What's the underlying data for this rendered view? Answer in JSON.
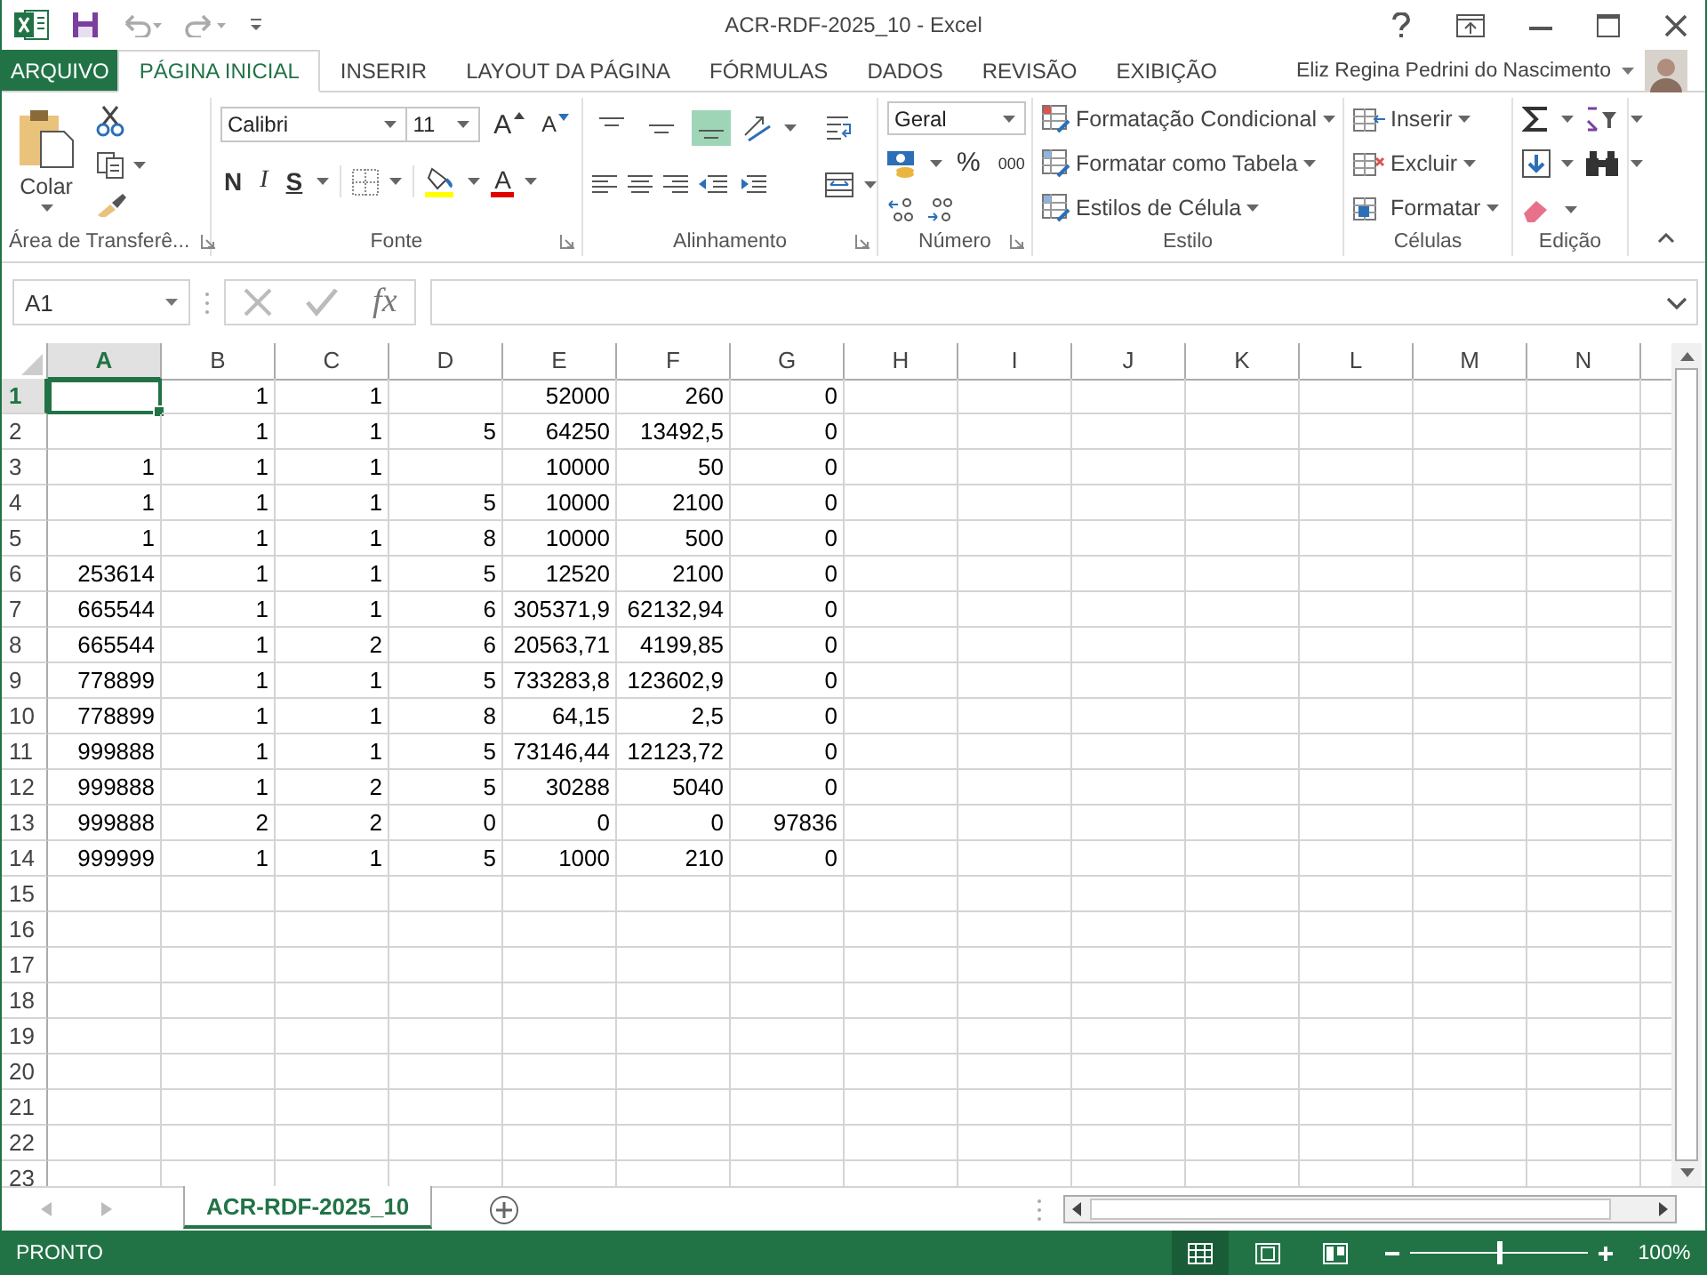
{
  "window": {
    "title": "ACR-RDF-2025_10 - Excel",
    "user": "Eliz Regina Pedrini do Nascimento"
  },
  "tabs": [
    {
      "label": "ARQUIVO",
      "kind": "file",
      "selected": false
    },
    {
      "label": "PÁGINA INICIAL",
      "kind": "tab",
      "selected": true
    },
    {
      "label": "INSERIR",
      "kind": "tab",
      "selected": false
    },
    {
      "label": "LAYOUT DA PÁGINA",
      "kind": "tab",
      "selected": false
    },
    {
      "label": "FÓRMULAS",
      "kind": "tab",
      "selected": false
    },
    {
      "label": "DADOS",
      "kind": "tab",
      "selected": false
    },
    {
      "label": "REVISÃO",
      "kind": "tab",
      "selected": false
    },
    {
      "label": "EXIBIÇÃO",
      "kind": "tab",
      "selected": false
    }
  ],
  "ribbon": {
    "clipboard": {
      "paste": "Colar",
      "label": "Área de Transferê..."
    },
    "font": {
      "name": "Calibri",
      "size": "11",
      "grow": "A",
      "shrink": "A",
      "bold": "N",
      "italic": "I",
      "underline": "S",
      "color_letter": "A",
      "label": "Fonte"
    },
    "alignment": {
      "vertical_align": [
        {
          "selected": false
        },
        {
          "selected": false
        },
        {
          "selected": true
        }
      ],
      "label": "Alinhamento"
    },
    "number": {
      "format": "Geral",
      "percent": "%",
      "thousands": "000",
      "label": "Número"
    },
    "styles": {
      "buttons": [
        "Formatação Condicional",
        "Formatar como Tabela",
        "Estilos de Célula"
      ],
      "label": "Estilo"
    },
    "cells": {
      "buttons": [
        "Inserir",
        "Excluir",
        "Formatar"
      ],
      "label": "Células"
    },
    "editing": {
      "label": "Edição"
    }
  },
  "formula_bar": {
    "name_box": "A1",
    "fx": "fx"
  },
  "sheet": {
    "columns": [
      {
        "label": "A",
        "selected": true
      },
      {
        "label": "B",
        "selected": false
      },
      {
        "label": "C",
        "selected": false
      },
      {
        "label": "D",
        "selected": false
      },
      {
        "label": "E",
        "selected": false
      },
      {
        "label": "F",
        "selected": false
      },
      {
        "label": "G",
        "selected": false
      },
      {
        "label": "H",
        "selected": false
      },
      {
        "label": "I",
        "selected": false
      },
      {
        "label": "J",
        "selected": false
      },
      {
        "label": "K",
        "selected": false
      },
      {
        "label": "L",
        "selected": false
      },
      {
        "label": "M",
        "selected": false
      },
      {
        "label": "N",
        "selected": false
      }
    ],
    "rows": [
      {
        "label": "1",
        "selected": true,
        "cells": [
          null,
          "1",
          "1",
          null,
          "52000",
          "260",
          "0"
        ]
      },
      {
        "label": "2",
        "selected": false,
        "cells": [
          null,
          "1",
          "1",
          "5",
          "64250",
          "13492,5",
          "0"
        ]
      },
      {
        "label": "3",
        "selected": false,
        "cells": [
          "1",
          "1",
          "1",
          null,
          "10000",
          "50",
          "0"
        ]
      },
      {
        "label": "4",
        "selected": false,
        "cells": [
          "1",
          "1",
          "1",
          "5",
          "10000",
          "2100",
          "0"
        ]
      },
      {
        "label": "5",
        "selected": false,
        "cells": [
          "1",
          "1",
          "1",
          "8",
          "10000",
          "500",
          "0"
        ]
      },
      {
        "label": "6",
        "selected": false,
        "cells": [
          "253614",
          "1",
          "1",
          "5",
          "12520",
          "2100",
          "0"
        ]
      },
      {
        "label": "7",
        "selected": false,
        "cells": [
          "665544",
          "1",
          "1",
          "6",
          "305371,9",
          "62132,94",
          "0"
        ]
      },
      {
        "label": "8",
        "selected": false,
        "cells": [
          "665544",
          "1",
          "2",
          "6",
          "20563,71",
          "4199,85",
          "0"
        ]
      },
      {
        "label": "9",
        "selected": false,
        "cells": [
          "778899",
          "1",
          "1",
          "5",
          "733283,8",
          "123602,9",
          "0"
        ]
      },
      {
        "label": "10",
        "selected": false,
        "cells": [
          "778899",
          "1",
          "1",
          "8",
          "64,15",
          "2,5",
          "0"
        ]
      },
      {
        "label": "11",
        "selected": false,
        "cells": [
          "999888",
          "1",
          "1",
          "5",
          "73146,44",
          "12123,72",
          "0"
        ]
      },
      {
        "label": "12",
        "selected": false,
        "cells": [
          "999888",
          "1",
          "2",
          "5",
          "30288",
          "5040",
          "0"
        ]
      },
      {
        "label": "13",
        "selected": false,
        "cells": [
          "999888",
          "2",
          "2",
          "0",
          "0",
          "0",
          "97836"
        ]
      },
      {
        "label": "14",
        "selected": false,
        "cells": [
          "999999",
          "1",
          "1",
          "5",
          "1000",
          "210",
          "0"
        ]
      },
      {
        "label": "15",
        "selected": false
      },
      {
        "label": "16",
        "selected": false
      },
      {
        "label": "17",
        "selected": false
      },
      {
        "label": "18",
        "selected": false
      },
      {
        "label": "19",
        "selected": false
      },
      {
        "label": "20",
        "selected": false
      },
      {
        "label": "21",
        "selected": false
      },
      {
        "label": "22",
        "selected": false
      },
      {
        "label": "23",
        "selected": false
      }
    ]
  },
  "sheet_tabs": [
    {
      "label": "ACR-RDF-2025_10",
      "selected": true
    }
  ],
  "status_bar": {
    "status": "PRONTO",
    "views": [
      {
        "selected": true
      },
      {
        "selected": false
      },
      {
        "selected": false
      }
    ],
    "zoom": {
      "level": 0.5,
      "reading": "100%"
    }
  }
}
